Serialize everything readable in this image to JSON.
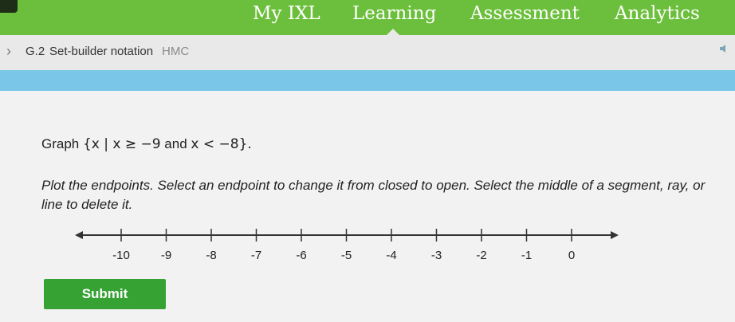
{
  "nav": {
    "items": [
      "My IXL",
      "Learning",
      "Assessment",
      "Analytics"
    ],
    "active": "Learning"
  },
  "breadcrumb": {
    "chevron": "›",
    "code": "G.2",
    "name": "Set-builder notation",
    "tag": "HMC"
  },
  "question": {
    "prefix": "Graph ",
    "set1": "{x | x ≥ −9",
    "conj": " and ",
    "set2": "x < −8}.",
    "instructions": "Plot the endpoints. Select an endpoint to change it from closed to open. Select the middle of a segment, ray, or line to delete it."
  },
  "number_line": {
    "min": -10,
    "max": 0,
    "tick_labels": [
      "-10",
      "-9",
      "-8",
      "-7",
      "-6",
      "-5",
      "-4",
      "-3",
      "-2",
      "-1",
      "0"
    ]
  },
  "submit": {
    "label": "Submit"
  },
  "colors": {
    "nav_bg": "#6cbf3c",
    "blue_band": "#79c6e8",
    "submit_bg": "#36a233"
  }
}
